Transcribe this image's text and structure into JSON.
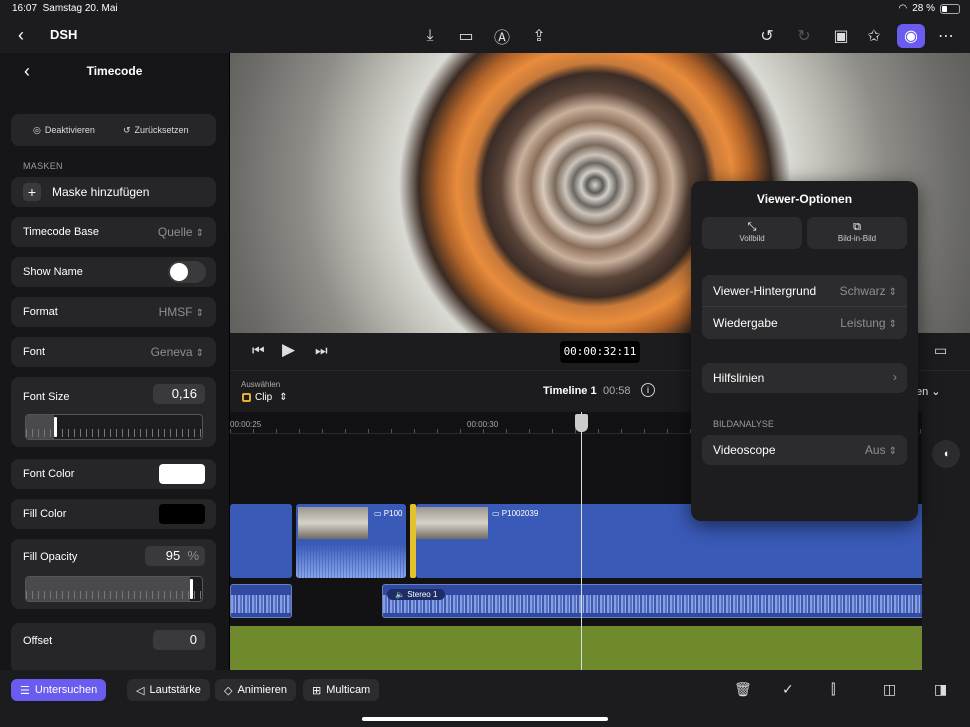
{
  "status": {
    "time": "16:07",
    "date": "Samstag 20. Mai",
    "battery": "28 %"
  },
  "topbar": {
    "project": "DSH"
  },
  "inspector": {
    "title": "Timecode",
    "deactivate": "Deaktivieren",
    "reset": "Zurücksetzen",
    "masks_section": "MASKEN",
    "add_mask": "Maske hinzufügen",
    "timecode_base": {
      "label": "Timecode Base",
      "value": "Quelle"
    },
    "show_name": {
      "label": "Show Name",
      "value": false
    },
    "format": {
      "label": "Format",
      "value": "HMSF"
    },
    "font": {
      "label": "Font",
      "value": "Geneva"
    },
    "font_size": {
      "label": "Font Size",
      "value": "0,16",
      "level": 0.16
    },
    "font_color": {
      "label": "Font Color",
      "color": "#ffffff"
    },
    "fill_color": {
      "label": "Fill Color",
      "color": "#000000"
    },
    "fill_opacity": {
      "label": "Fill Opacity",
      "value": "95",
      "unit": "%",
      "level": 0.95
    },
    "offset": {
      "label": "Offset",
      "value": "0"
    }
  },
  "viewer": {
    "timecode": "00:00:32:11"
  },
  "timeline_header": {
    "select_label": "Auswählen",
    "clip_label": "Clip",
    "timeline_name": "Timeline 1",
    "duration": "00:58",
    "partial_label": "en"
  },
  "timeline": {
    "ruler_labels": [
      "00:00:25",
      "00:00:30"
    ],
    "clip1_name": "P100",
    "clip2_name": "P1002039",
    "audio_name": "Stereo 1"
  },
  "popover": {
    "title": "Viewer-Optionen",
    "fullscreen": "Vollbild",
    "pip": "Bild-in-Bild",
    "background": {
      "label": "Viewer-Hintergrund",
      "value": "Schwarz"
    },
    "playback": {
      "label": "Wiedergabe",
      "value": "Leistung"
    },
    "guides": {
      "label": "Hilfslinien"
    },
    "analysis_section": "BILDANALYSE",
    "videoscope": {
      "label": "Videoscope",
      "value": "Aus"
    }
  },
  "bottombar": {
    "inspect": "Untersuchen",
    "volume": "Lautstärke",
    "animate": "Animieren",
    "multicam": "Multicam"
  },
  "colors": {
    "accent": "#6b5cf0",
    "clip": "#3a5ab8",
    "trim": "#e2c12c",
    "track_green": "#6e8a2c"
  }
}
